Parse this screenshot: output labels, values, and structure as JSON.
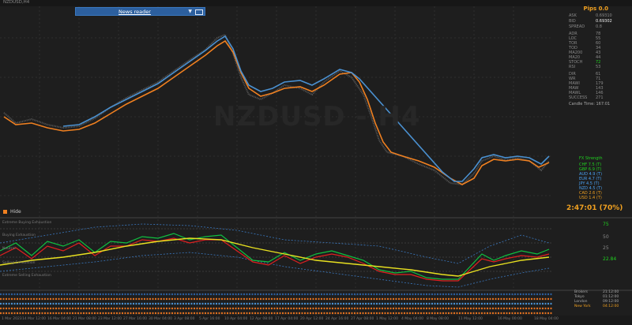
{
  "window": {
    "title": "NZDUSD,H4"
  },
  "news_reader": {
    "label": "News reader",
    "arrow": "▼"
  },
  "watermark": "NZDUSD - H4",
  "pips": {
    "label": "Pips 0.0"
  },
  "info_panel": {
    "rows": [
      {
        "label": "ASK",
        "value": "0.69310"
      },
      {
        "label": "BID",
        "value": "0.69302"
      },
      {
        "label": "SPREAD",
        "value": "0.8"
      },
      {
        "label": "ADR",
        "value": "78"
      },
      {
        "label": "LOC",
        "value": "55"
      },
      {
        "label": "TOR",
        "value": "60"
      },
      {
        "label": "TOD",
        "value": "34"
      },
      {
        "label": "MA200",
        "value": "43"
      },
      {
        "label": "MA20",
        "value": "44"
      },
      {
        "label": "STOCH",
        "value": "72"
      },
      {
        "label": "RSI",
        "value": "53"
      },
      {
        "label": "DIR",
        "value": "61"
      },
      {
        "label": "WR",
        "value": "71"
      },
      {
        "label": "MAWI",
        "value": "179"
      },
      {
        "label": "MAW",
        "value": "143"
      },
      {
        "label": "MAWL",
        "value": "146"
      },
      {
        "label": "SUCCESS",
        "value": "271"
      }
    ],
    "candle_time": "Candle Time: 167:01"
  },
  "currency_strength": {
    "header": "FX Strength",
    "rows": [
      {
        "label": "CHF",
        "value": "7.5 (T)",
        "color": "#20d020"
      },
      {
        "label": "GBP",
        "value": "6.9 (T)",
        "color": "#20d020"
      },
      {
        "label": "AUD",
        "value": "4.9 (T)",
        "color": "#4aa0f0"
      },
      {
        "label": "EUR",
        "value": "4.7 (T)",
        "color": "#4aa0f0"
      },
      {
        "label": "JPY",
        "value": "4.5 (T)",
        "color": "#4aa0f0"
      },
      {
        "label": "NZD",
        "value": "4.5 (T)",
        "color": "#4aa0f0"
      },
      {
        "label": "CAD",
        "value": "2.6 (T)",
        "color": "#f0a020"
      },
      {
        "label": "USD",
        "value": "1.4 (T)",
        "color": "#f0a020"
      }
    ]
  },
  "countdown": "2:47:01 (70%)",
  "hide_label": "Hide",
  "subwindow": {
    "labels": [
      {
        "text": "Extreme Buying Exhaustion"
      },
      {
        "text": "Buying Exhaustion"
      },
      {
        "text": "Neutral"
      },
      {
        "text": "Selling Exhaustion"
      },
      {
        "text": "Extreme Selling Exhaustion"
      }
    ],
    "right_values": [
      "75",
      "50",
      "25",
      "22.84"
    ]
  },
  "sessions": [
    {
      "label": "Brokers",
      "time": "21:12:00"
    },
    {
      "label": "Tokyo",
      "time": "01:12:00"
    },
    {
      "label": "London",
      "time": "09:12:00"
    },
    {
      "label": "New York",
      "time": "04:12:00"
    }
  ],
  "date_axis": [
    "1 Mar 2023",
    "14 Mar 12:00",
    "16 Mar 04:00",
    "21 Mar 08:00",
    "23 Mar 12:00",
    "27 Mar 16:00",
    "30 Mar 04:00",
    "3 Apr 08:00",
    "5 Apr 16:00",
    "10 Apr 04:00",
    "12 Apr 08:00",
    "17 Apr 04:00",
    "20 Apr 12:00",
    "24 Apr 16:00",
    "27 Apr 08:00",
    "1 May 12:00",
    "4 May 04:00",
    "8 May 08:00",
    "11 May 12:00",
    "16 May 00:00",
    "18 May 04:00"
  ],
  "colors": {
    "orange": "#f08020",
    "blue": "#4a90d0",
    "red": "#e02020",
    "green": "#10c040",
    "yellow": "#e8e020"
  }
}
